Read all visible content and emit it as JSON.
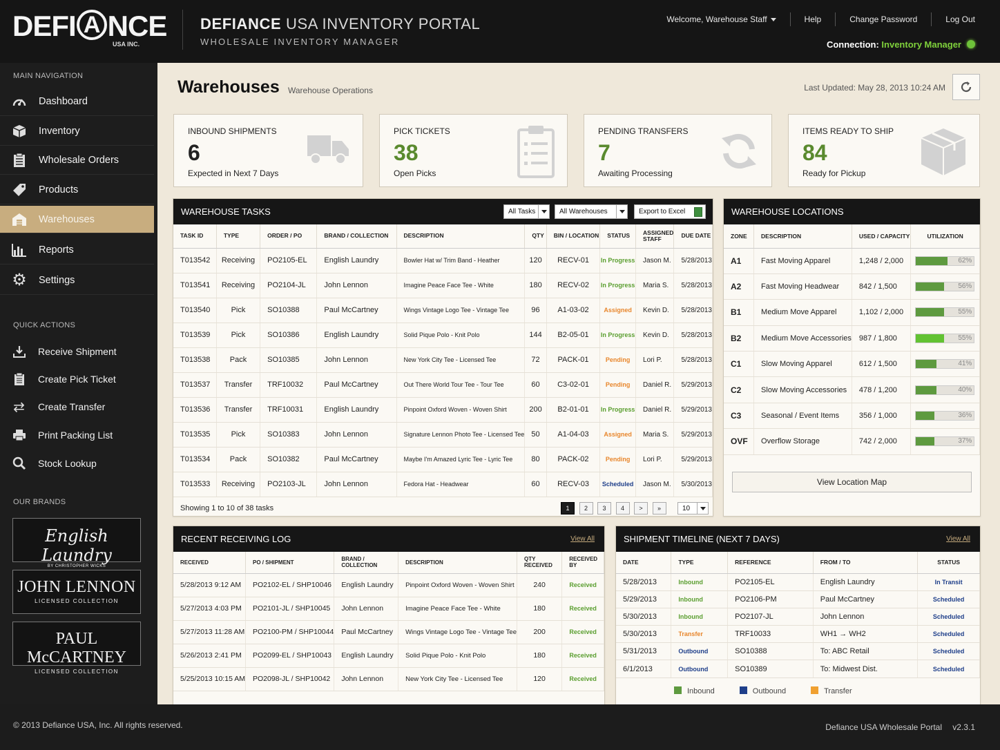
{
  "header": {
    "logo_left": "DEFI",
    "logo_circle": "A",
    "logo_right": "NCE",
    "logo_sub": "USA INC.",
    "portal_title_a": "DEFIANCE",
    "portal_title_b": "USA INVENTORY PORTAL",
    "portal_subtitle": "WHOLESALE INVENTORY MANAGER",
    "welcome": "Welcome, Warehouse Staff",
    "help": "Help",
    "change_password": "Change Password",
    "logout": "Log Out",
    "connection_label": "Connection:",
    "connection_value": "Inventory Manager"
  },
  "sidebar": {
    "main_nav_heading": "MAIN NAVIGATION",
    "items": [
      {
        "label": "Dashboard",
        "icon": "dashboard-icon"
      },
      {
        "label": "Inventory",
        "icon": "box-icon"
      },
      {
        "label": "Wholesale Orders",
        "icon": "clipboard-icon"
      },
      {
        "label": "Products",
        "icon": "tag-icon"
      },
      {
        "label": "Warehouses",
        "icon": "warehouse-icon",
        "active": true
      },
      {
        "label": "Reports",
        "icon": "bar-chart-icon"
      },
      {
        "label": "Settings",
        "icon": "gear-icon"
      }
    ],
    "quick_actions_heading": "QUICK ACTIONS",
    "quick_actions": [
      {
        "label": "Receive Shipment",
        "icon": "download-icon"
      },
      {
        "label": "Create Pick Ticket",
        "icon": "clipboard-icon"
      },
      {
        "label": "Create Transfer",
        "icon": "transfer-icon"
      },
      {
        "label": "Print Packing List",
        "icon": "printer-icon"
      },
      {
        "label": "Stock Lookup",
        "icon": "search-icon"
      }
    ],
    "brands_heading": "OUR BRANDS",
    "brands": [
      {
        "name": "English Laundry",
        "tagline": "BY CHRISTOPHER WICKS"
      },
      {
        "name": "JOHN LENNON",
        "tagline": "LICENSED COLLECTION"
      },
      {
        "name": "PAUL McCARTNEY",
        "tagline": "LICENSED COLLECTION"
      }
    ]
  },
  "page": {
    "title": "Warehouses",
    "subtitle": "Warehouse Operations",
    "last_updated": "Last Updated: May 28, 2013 10:24 AM"
  },
  "stats": [
    {
      "label": "INBOUND SHIPMENTS",
      "value": "6",
      "sub": "Expected in Next 7 Days",
      "color": "#222222",
      "icon": "truck-icon"
    },
    {
      "label": "PICK TICKETS",
      "value": "38",
      "sub": "Open Picks",
      "color": "#5a8a2e",
      "icon": "clipboard-icon"
    },
    {
      "label": "PENDING TRANSFERS",
      "value": "7",
      "sub": "Awaiting Processing",
      "color": "#5a8a2e",
      "icon": "refresh-icon"
    },
    {
      "label": "ITEMS READY TO SHIP",
      "value": "84",
      "sub": "Ready for Pickup",
      "color": "#5a8a2e",
      "icon": "package-icon"
    }
  ],
  "tasks": {
    "title": "WAREHOUSE TASKS",
    "filter_tasks": "All Tasks",
    "filter_warehouses": "All Warehouses",
    "export": "Export to Excel",
    "columns": [
      "TASK ID",
      "TYPE",
      "ORDER / PO",
      "BRAND / COLLECTION",
      "DESCRIPTION",
      "QTY",
      "BIN / LOCATION",
      "STATUS",
      "ASSIGNED STAFF",
      "DUE DATE"
    ],
    "rows": [
      [
        "T013542",
        "Receiving",
        "PO2105-EL",
        "English Laundry",
        "Bowler Hat w/ Trim Band - Heather",
        "120",
        "RECV-01",
        "In Progress",
        "Jason M.",
        "5/28/2013"
      ],
      [
        "T013541",
        "Receiving",
        "PO2104-JL",
        "John Lennon",
        "Imagine Peace Face Tee - White",
        "180",
        "RECV-02",
        "In Progress",
        "Maria S.",
        "5/28/2013"
      ],
      [
        "T013540",
        "Pick",
        "SO10388",
        "Paul McCartney",
        "Wings Vintage Logo Tee - Vintage Tee",
        "96",
        "A1-03-02",
        "Assigned",
        "Kevin D.",
        "5/28/2013"
      ],
      [
        "T013539",
        "Pick",
        "SO10386",
        "English Laundry",
        "Solid Pique Polo - Knit Polo",
        "144",
        "B2-05-01",
        "In Progress",
        "Kevin D.",
        "5/28/2013"
      ],
      [
        "T013538",
        "Pack",
        "SO10385",
        "John Lennon",
        "New York City Tee - Licensed Tee",
        "72",
        "PACK-01",
        "Pending",
        "Lori P.",
        "5/28/2013"
      ],
      [
        "T013537",
        "Transfer",
        "TRF10032",
        "Paul McCartney",
        "Out There World Tour Tee - Tour Tee",
        "60",
        "C3-02-01",
        "Pending",
        "Daniel R.",
        "5/29/2013"
      ],
      [
        "T013536",
        "Transfer",
        "TRF10031",
        "English Laundry",
        "Pinpoint Oxford Woven - Woven Shirt",
        "200",
        "B2-01-01",
        "In Progress",
        "Daniel R.",
        "5/29/2013"
      ],
      [
        "T013535",
        "Pick",
        "SO10383",
        "John Lennon",
        "Signature Lennon Photo Tee - Licensed Tee",
        "50",
        "A1-04-03",
        "Assigned",
        "Maria S.",
        "5/29/2013"
      ],
      [
        "T013534",
        "Pack",
        "SO10382",
        "Paul McCartney",
        "Maybe I'm Amazed Lyric Tee - Lyric Tee",
        "80",
        "PACK-02",
        "Pending",
        "Lori P.",
        "5/29/2013"
      ],
      [
        "T013533",
        "Receiving",
        "PO2103-JL",
        "John Lennon",
        "Fedora Hat - Headwear",
        "60",
        "RECV-03",
        "Scheduled",
        "Jason M.",
        "5/30/2013"
      ]
    ],
    "showing": "Showing 1 to 10 of 38 tasks",
    "pages": [
      "1",
      "2",
      "3",
      "4",
      ">",
      "»"
    ],
    "page_size": "10"
  },
  "locations": {
    "title": "WAREHOUSE LOCATIONS",
    "columns": [
      "ZONE",
      "DESCRIPTION",
      "USED / CAPACITY",
      "UTILIZATION"
    ],
    "rows": [
      {
        "zone": "A1",
        "desc": "Fast Moving Apparel",
        "used": "1,248 / 2,000",
        "pct": 62,
        "pct_label": "62%"
      },
      {
        "zone": "A2",
        "desc": "Fast Moving Headwear",
        "used": "842 / 1,500",
        "pct": 56,
        "pct_label": "56%"
      },
      {
        "zone": "B1",
        "desc": "Medium Move Apparel",
        "used": "1,102 / 2,000",
        "pct": 55,
        "pct_label": "55%"
      },
      {
        "zone": "B2",
        "desc": "Medium Move Accessories",
        "used": "987 / 1,800",
        "pct": 55,
        "pct_label": "55%"
      },
      {
        "zone": "C1",
        "desc": "Slow Moving Apparel",
        "used": "612 / 1,500",
        "pct": 41,
        "pct_label": "41%"
      },
      {
        "zone": "C2",
        "desc": "Slow Moving Accessories",
        "used": "478 / 1,200",
        "pct": 40,
        "pct_label": "40%"
      },
      {
        "zone": "C3",
        "desc": "Seasonal / Event Items",
        "used": "356 / 1,000",
        "pct": 36,
        "pct_label": "36%"
      },
      {
        "zone": "OVF",
        "desc": "Overflow Storage",
        "used": "742 / 2,000",
        "pct": 37,
        "pct_label": "37%"
      }
    ],
    "map_button": "View Location Map"
  },
  "receiving": {
    "title": "RECENT RECEIVING LOG",
    "view_all": "View All",
    "columns": [
      "RECEIVED",
      "PO / SHIPMENT",
      "BRAND / COLLECTION",
      "DESCRIPTION",
      "QTY RECEIVED",
      "RECEIVED BY"
    ],
    "rows": [
      [
        "5/28/2013 9:12 AM",
        "PO2102-EL / SHP10046",
        "English Laundry",
        "Pinpoint Oxford Woven - Woven Shirt",
        "240",
        "Received"
      ],
      [
        "5/27/2013 4:03 PM",
        "PO2101-JL / SHP10045",
        "John Lennon",
        "Imagine Peace Face Tee - White",
        "180",
        "Received"
      ],
      [
        "5/27/2013 11:28 AM",
        "PO2100-PM / SHP10044",
        "Paul McCartney",
        "Wings Vintage Logo Tee - Vintage Tee",
        "200",
        "Received"
      ],
      [
        "5/26/2013 2:41 PM",
        "PO2099-EL / SHP10043",
        "English Laundry",
        "Solid Pique Polo - Knit Polo",
        "180",
        "Received"
      ],
      [
        "5/25/2013 10:15 AM",
        "PO2098-JL / SHP10042",
        "John Lennon",
        "New York City Tee - Licensed Tee",
        "120",
        "Received"
      ]
    ]
  },
  "timeline": {
    "title": "SHIPMENT TIMELINE (NEXT 7 DAYS)",
    "view_all": "View All",
    "columns": [
      "DATE",
      "TYPE",
      "REFERENCE",
      "FROM / TO",
      "STATUS"
    ],
    "rows": [
      [
        "5/28/2013",
        "Inbound",
        "PO2105-EL",
        "English Laundry",
        "In Transit"
      ],
      [
        "5/29/2013",
        "Inbound",
        "PO2106-PM",
        "Paul McCartney",
        "Scheduled"
      ],
      [
        "5/30/2013",
        "Inbound",
        "PO2107-JL",
        "John Lennon",
        "Scheduled"
      ],
      [
        "5/30/2013",
        "Transfer",
        "TRF10033",
        "WH1 → WH2",
        "Scheduled"
      ],
      [
        "5/31/2013",
        "Outbound",
        "SO10388",
        "To: ABC Retail",
        "Scheduled"
      ],
      [
        "6/1/2013",
        "Outbound",
        "SO10389",
        "To: Midwest Dist.",
        "Scheduled"
      ]
    ],
    "legend": [
      {
        "label": "Inbound",
        "color": "#5e9a3f"
      },
      {
        "label": "Outbound",
        "color": "#1f3f8a"
      },
      {
        "label": "Transfer",
        "color": "#f0a030"
      }
    ]
  },
  "footer": {
    "copyright": "© 2013 Defiance USA, Inc. All rights reserved.",
    "portal": "Defiance USA Wholesale Portal",
    "version": "v2.3.1"
  }
}
